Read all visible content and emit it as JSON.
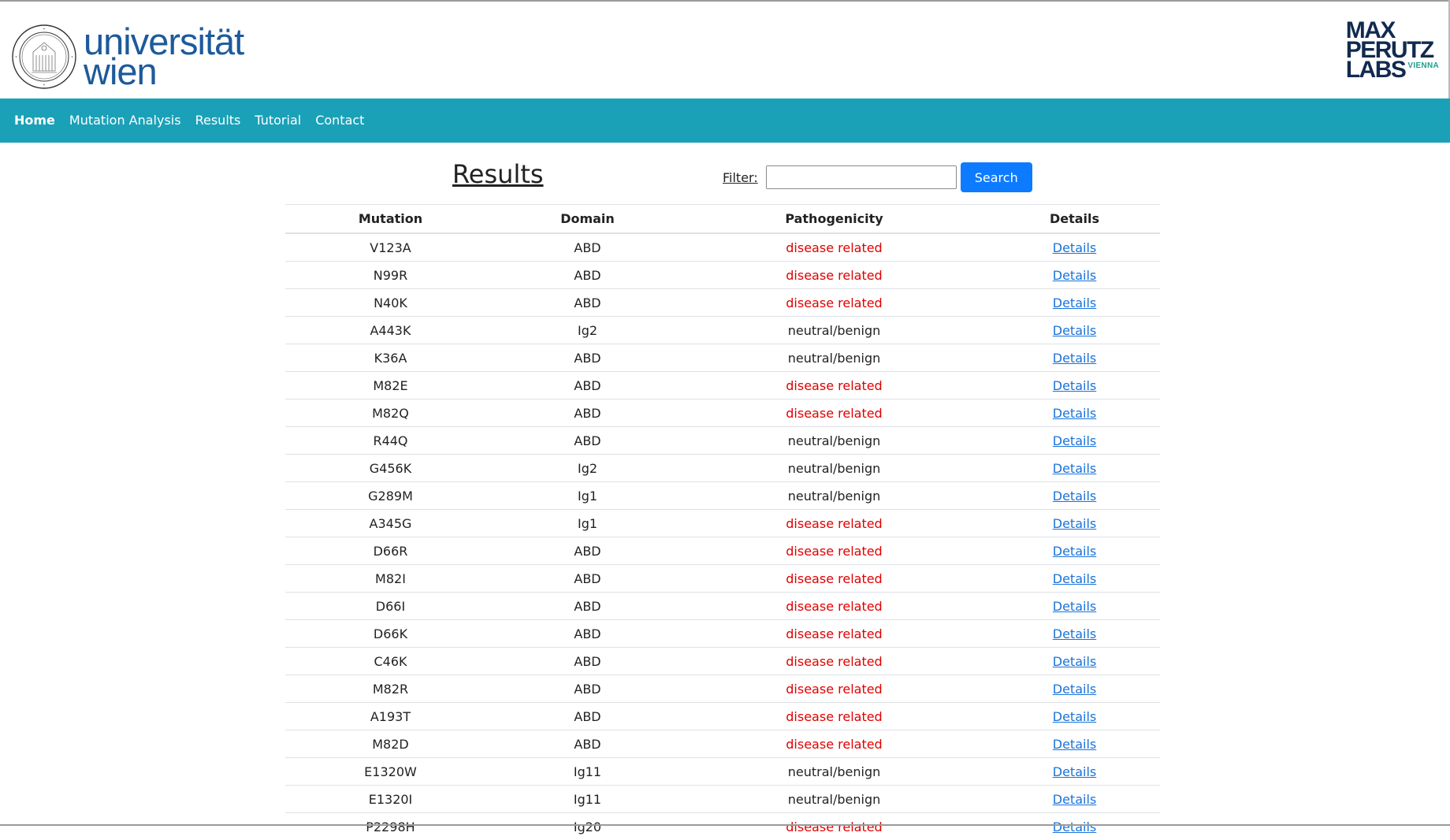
{
  "header": {
    "university_logo_lines": [
      "universität",
      "wien"
    ],
    "institute_logo_lines": [
      "MAX",
      "PERUTZ",
      "LABS"
    ],
    "institute_logo_tag": "VIENNA"
  },
  "nav": {
    "items": [
      {
        "label": "Home",
        "active": true
      },
      {
        "label": "Mutation Analysis"
      },
      {
        "label": "Results"
      },
      {
        "label": "Tutorial"
      },
      {
        "label": "Contact"
      }
    ]
  },
  "main": {
    "title": "Results",
    "filter": {
      "label": "Filter:",
      "value": "",
      "button": "Search"
    }
  },
  "colors": {
    "nav_bg": "#1aa1b8",
    "disease": "#e00000",
    "link": "#1a73d9",
    "button": "#0d7bff"
  },
  "table": {
    "headers": [
      "Mutation",
      "Domain",
      "Pathogenicity",
      "Details"
    ],
    "rows": [
      [
        "V123A",
        "ABD",
        "disease related",
        "Details"
      ],
      [
        "N99R",
        "ABD",
        "disease related",
        "Details"
      ],
      [
        "N40K",
        "ABD",
        "disease related",
        "Details"
      ],
      [
        "A443K",
        "Ig2",
        "neutral/benign",
        "Details"
      ],
      [
        "K36A",
        "ABD",
        "neutral/benign",
        "Details"
      ],
      [
        "M82E",
        "ABD",
        "disease related",
        "Details"
      ],
      [
        "M82Q",
        "ABD",
        "disease related",
        "Details"
      ],
      [
        "R44Q",
        "ABD",
        "neutral/benign",
        "Details"
      ],
      [
        "G456K",
        "Ig2",
        "neutral/benign",
        "Details"
      ],
      [
        "G289M",
        "Ig1",
        "neutral/benign",
        "Details"
      ],
      [
        "A345G",
        "Ig1",
        "disease related",
        "Details"
      ],
      [
        "D66R",
        "ABD",
        "disease related",
        "Details"
      ],
      [
        "M82I",
        "ABD",
        "disease related",
        "Details"
      ],
      [
        "D66I",
        "ABD",
        "disease related",
        "Details"
      ],
      [
        "D66K",
        "ABD",
        "disease related",
        "Details"
      ],
      [
        "C46K",
        "ABD",
        "disease related",
        "Details"
      ],
      [
        "M82R",
        "ABD",
        "disease related",
        "Details"
      ],
      [
        "A193T",
        "ABD",
        "disease related",
        "Details"
      ],
      [
        "M82D",
        "ABD",
        "disease related",
        "Details"
      ],
      [
        "E1320W",
        "Ig11",
        "neutral/benign",
        "Details"
      ],
      [
        "E1320I",
        "Ig11",
        "neutral/benign",
        "Details"
      ],
      [
        "P2298H",
        "Ig20",
        "disease related",
        "Details"
      ]
    ]
  }
}
